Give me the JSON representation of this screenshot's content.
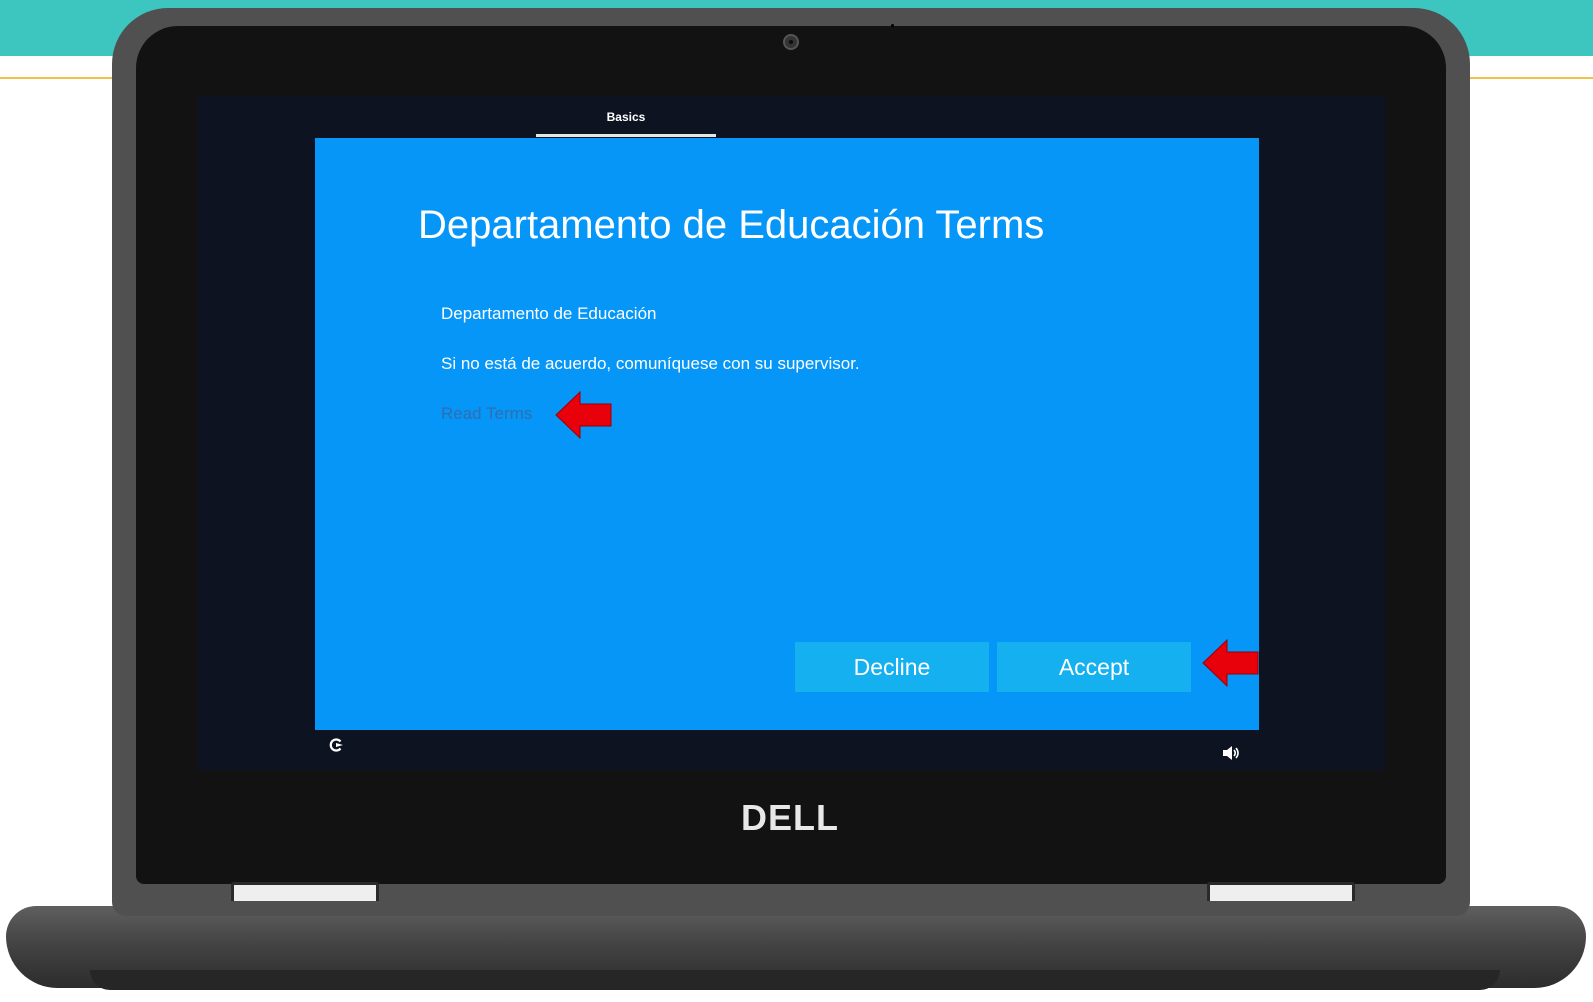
{
  "setup_tab": {
    "label": "Basics"
  },
  "dialog": {
    "title": "Departamento de Educación Terms",
    "organization": "Departamento de Educación",
    "notice": "Si no está de acuerdo, comuníquese con su supervisor.",
    "read_terms_link": "Read Terms",
    "decline_label": "Decline",
    "accept_label": "Accept"
  },
  "status_icons": {
    "left": "accessibility-icon",
    "right": "volume-icon"
  },
  "device": {
    "brand_logo": "DELL"
  },
  "colors": {
    "dialog_background": "#0596f8",
    "button_background": "#14b0ef",
    "annotation_arrow": "#e8000b",
    "top_band": "#3cc6bf"
  }
}
